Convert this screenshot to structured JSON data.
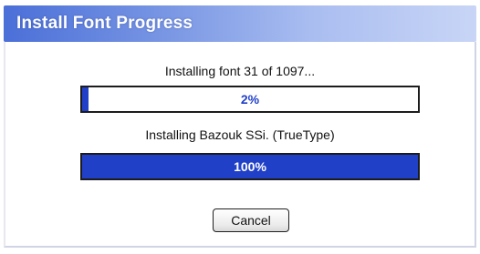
{
  "window": {
    "title": "Install Font Progress"
  },
  "overall": {
    "status_text": "Installing font 31 of 1097...",
    "progress_percent": 2,
    "progress_label": "2%"
  },
  "current": {
    "status_text": "Installing Bazouk SSi. (TrueType)",
    "progress_percent": 100,
    "progress_label": "100%"
  },
  "buttons": {
    "cancel_label": "Cancel"
  },
  "colors": {
    "progress_fill": "#2140c8",
    "title_bar": "#4a6fd8"
  }
}
